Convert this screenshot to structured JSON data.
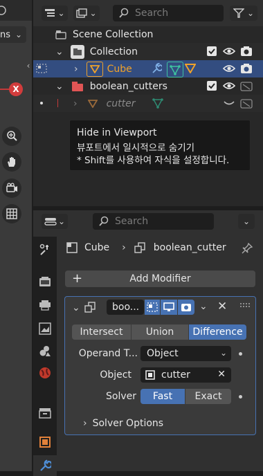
{
  "viewport": {
    "view_mode_fragment": "ns",
    "close_glyph": "X",
    "tools": [
      "zoom-icon",
      "hand-icon",
      "camera-icon",
      "grid-icon"
    ]
  },
  "outliner": {
    "search_placeholder": "Search",
    "scene_collection": "Scene Collection",
    "rows": [
      {
        "label": "Collection"
      },
      {
        "label": "Cube",
        "color": "#f0a22a"
      },
      {
        "label": "boolean_cutters"
      },
      {
        "label": "cutter"
      }
    ]
  },
  "tooltip": {
    "title": "Hide in Viewport",
    "line1": "뷰포트에서 일시적으로 숨기기",
    "line2": "* Shift를 사용하여 자식을 설정합니다."
  },
  "properties": {
    "search_placeholder": "Search",
    "breadcrumb": {
      "object": "Cube",
      "modifier": "boolean_cutter"
    },
    "add_modifier": "Add Modifier",
    "modifier": {
      "name_field": "boo...",
      "operations": [
        "Intersect",
        "Union",
        "Difference"
      ],
      "active_operation": "Difference",
      "operand_label": "Operand T...",
      "operand_value": "Object",
      "object_label": "Object",
      "object_value": "cutter",
      "solver_label": "Solver",
      "solvers": [
        "Fast",
        "Exact"
      ],
      "active_solver": "Fast",
      "solver_options": "Solver Options"
    }
  },
  "colors": {
    "accent": "#4772b3",
    "selected_row": "#334d80",
    "panel": "#303030",
    "orange": "#e1813a"
  }
}
